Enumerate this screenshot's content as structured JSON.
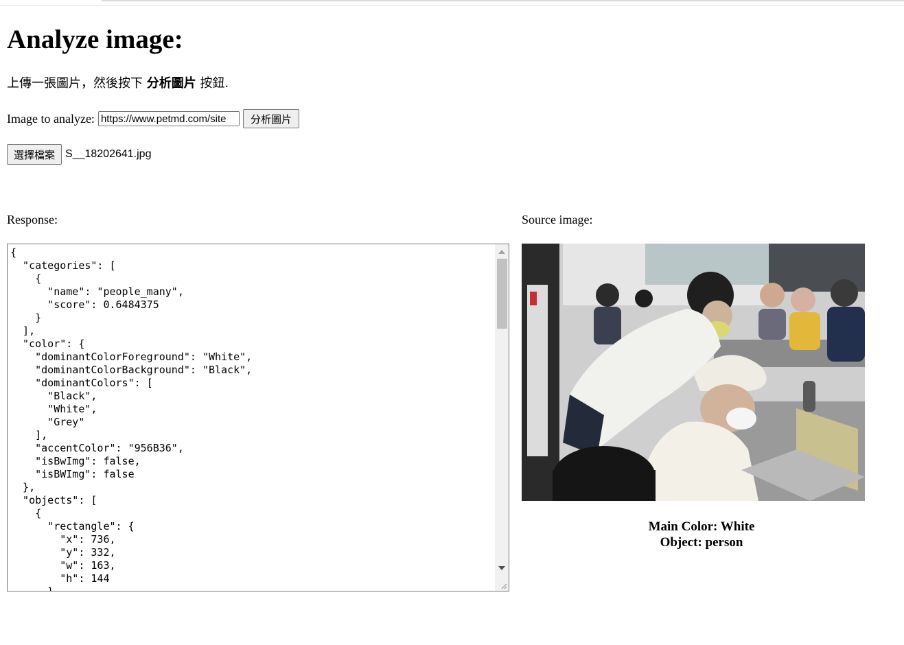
{
  "page": {
    "heading": "Analyze image:",
    "instruction_prefix": "上傳一張圖片，然後按下 ",
    "instruction_bold": "分析圖片",
    "instruction_suffix": " 按鈕."
  },
  "form": {
    "image_label": "Image to analyze:",
    "url_value": "https://www.petmd.com/site",
    "analyze_button": "分析圖片",
    "choose_file_button": "選擇檔案",
    "file_name": "S__18202641.jpg"
  },
  "response": {
    "label": "Response:",
    "json_text": "{\n  \"categories\": [\n    {\n      \"name\": \"people_many\",\n      \"score\": 0.6484375\n    }\n  ],\n  \"color\": {\n    \"dominantColorForeground\": \"White\",\n    \"dominantColorBackground\": \"Black\",\n    \"dominantColors\": [\n      \"Black\",\n      \"White\",\n      \"Grey\"\n    ],\n    \"accentColor\": \"956B36\",\n    \"isBwImg\": false,\n    \"isBWImg\": false\n  },\n  \"objects\": [\n    {\n      \"rectangle\": {\n        \"x\": 736,\n        \"y\": 332,\n        \"w\": 163,\n        \"h\": 144\n      },"
  },
  "source": {
    "label": "Source image:",
    "main_color_line": "Main Color: White",
    "object_line": "Object: person"
  },
  "icons": {
    "resize": "resize-grip-icon",
    "scroll_up": "scroll-up-arrow-icon",
    "scroll_down": "scroll-down-arrow-icon"
  },
  "colors": {
    "button_bg": "#efefef",
    "border": "#767676",
    "scroll_track": "#f1f1f1",
    "scroll_thumb": "#c1c1c1"
  }
}
